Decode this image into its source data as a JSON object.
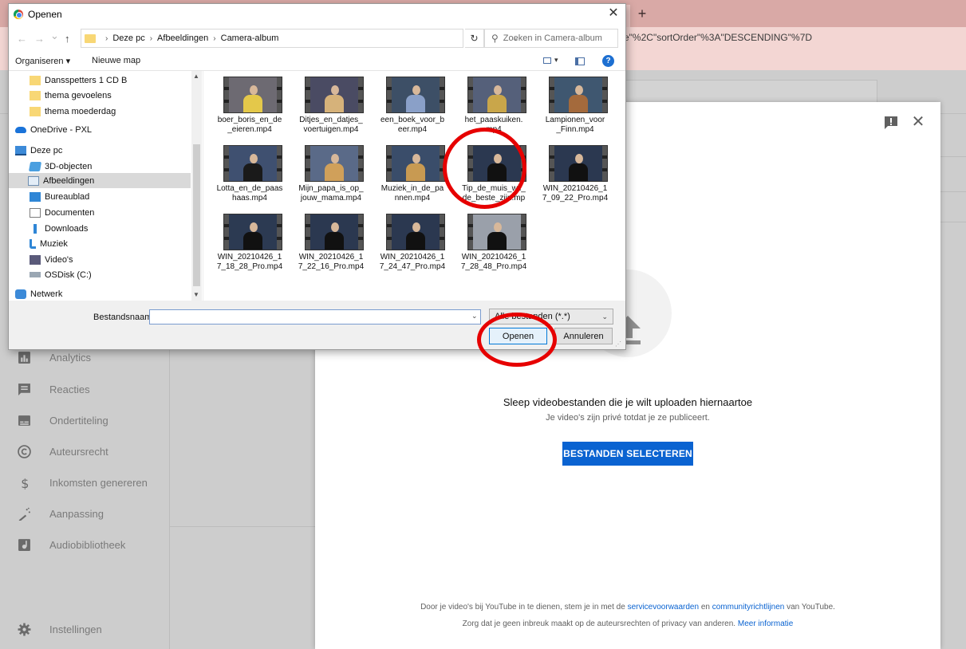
{
  "browser": {
    "new_tab": "+",
    "url_fragment": "e\"%2C\"sortOrder\"%3A\"DESCENDING\"%7D"
  },
  "studio_sidebar": {
    "items": [
      {
        "label": "Analytics",
        "icon": "analytics-icon"
      },
      {
        "label": "Reacties",
        "icon": "comments-icon"
      },
      {
        "label": "Ondertiteling",
        "icon": "subtitles-icon"
      },
      {
        "label": "Auteursrecht",
        "icon": "copyright-icon"
      },
      {
        "label": "Inkomsten genereren",
        "icon": "dollar-icon"
      },
      {
        "label": "Aanpassing",
        "icon": "magic-wand-icon"
      },
      {
        "label": "Audiobibliotheek",
        "icon": "audio-library-icon"
      },
      {
        "label": "Instellingen",
        "icon": "gear-icon"
      }
    ]
  },
  "upload_modal": {
    "close": "✕",
    "drop_title": "Sleep videobestanden die je wilt uploaden hiernaartoe",
    "drop_subtitle": "Je video's zijn privé totdat je ze publiceert.",
    "select_button": "BESTANDEN SELECTEREN",
    "footer": {
      "line1_prefix": "Door je video's bij YouTube in te dienen, stem je in met de ",
      "terms_link": "servicevoorwaarden",
      "line1_mid": " en ",
      "guidelines_link": "communityrichtlijnen",
      "line1_suffix": " van YouTube.",
      "line2_prefix": "Zorg dat je geen inbreuk maakt op de auteursrechten of privacy van anderen. ",
      "more_link": "Meer informatie"
    }
  },
  "dialog": {
    "title": "Openen",
    "close": "✕",
    "nav": {
      "back": "←",
      "forward": "→",
      "recent": "⌄",
      "up": "↑"
    },
    "breadcrumb": [
      "Deze pc",
      "Afbeeldingen",
      "Camera-album"
    ],
    "breadcrumb_sep": "›",
    "refresh": "↻",
    "search_placeholder": "Zoeken in Camera-album",
    "toolbar": {
      "organize": "Organiseren ▾",
      "new_folder": "Nieuwe map",
      "help": "?"
    },
    "tree": [
      {
        "label": "Dansspetters 1 CD B",
        "type": "folder"
      },
      {
        "label": "thema gevoelens",
        "type": "folder"
      },
      {
        "label": "thema moederdag",
        "type": "folder"
      },
      {
        "label": "OneDrive - PXL",
        "type": "onedrive"
      },
      {
        "label": "Deze pc",
        "type": "pc"
      },
      {
        "label": "3D-objecten",
        "type": "3d"
      },
      {
        "label": "Afbeeldingen",
        "type": "pictures"
      },
      {
        "label": "Bureaublad",
        "type": "desktop"
      },
      {
        "label": "Documenten",
        "type": "documents"
      },
      {
        "label": "Downloads",
        "type": "downloads"
      },
      {
        "label": "Muziek",
        "type": "music"
      },
      {
        "label": "Video's",
        "type": "videos"
      },
      {
        "label": "OSDisk (C:)",
        "type": "disk"
      },
      {
        "label": "Netwerk",
        "type": "network"
      }
    ],
    "files": [
      {
        "name": "boer_boris_en_de_eieren.mp4",
        "l1": "boer_boris_en_de",
        "l2": "_eieren.mp4"
      },
      {
        "name": "Ditjes_en_datjes_voertuigen.mp4",
        "l1": "Ditjes_en_datjes_",
        "l2": "voertuigen.mp4"
      },
      {
        "name": "een_boek_voor_beer.mp4",
        "l1": "een_boek_voor_b",
        "l2": "eer.mp4"
      },
      {
        "name": "het_paaskuiken.mp4",
        "l1": "het_paaskuiken.",
        "l2": "mp4"
      },
      {
        "name": "Lampionen_voor_Finn.mp4",
        "l1": "Lampionen_voor",
        "l2": "_Finn.mp4"
      },
      {
        "name": "Lotta_en_de_paashaas.mp4",
        "l1": "Lotta_en_de_paas",
        "l2": "haas.mp4"
      },
      {
        "name": "Mijn_papa_is_op_jouw_mama.mp4",
        "l1": "Mijn_papa_is_op_",
        "l2": "jouw_mama.mp4"
      },
      {
        "name": "Muziek_in_de_pannen.mp4",
        "l1": "Muziek_in_de_pa",
        "l2": "nnen.mp4"
      },
      {
        "name": "Tip_de_muis_wil_de_beste_zijn.mp4",
        "l1": "Tip_de_muis_wil_",
        "l2": "de_beste_zijn.mp"
      },
      {
        "name": "WIN_20210426_17_09_22_Pro.mp4",
        "l1": "WIN_20210426_1",
        "l2": "7_09_22_Pro.mp4"
      },
      {
        "name": "WIN_20210426_17_18_28_Pro.mp4",
        "l1": "WIN_20210426_1",
        "l2": "7_18_28_Pro.mp4"
      },
      {
        "name": "WIN_20210426_17_22_16_Pro.mp4",
        "l1": "WIN_20210426_1",
        "l2": "7_22_16_Pro.mp4"
      },
      {
        "name": "WIN_20210426_17_24_47_Pro.mp4",
        "l1": "WIN_20210426_1",
        "l2": "7_24_47_Pro.mp4"
      },
      {
        "name": "WIN_20210426_17_28_48_Pro.mp4",
        "l1": "WIN_20210426_1",
        "l2": "7_28_48_Pro.mp4"
      }
    ],
    "filename_label": "Bestandsnaam:",
    "filename_value": "",
    "filetype": "Alle bestanden (*.*)",
    "open_button": "Openen",
    "cancel_button": "Annuleren"
  },
  "colors": {
    "accent": "#0a63d1",
    "annotation": "#e60000",
    "browser_frame": "#d9a9a6"
  }
}
